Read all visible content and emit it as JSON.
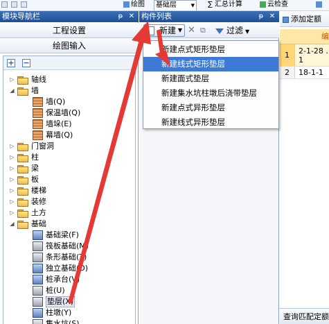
{
  "toolbar": {
    "items": [
      {
        "label": "绘图",
        "icon": "draw-icon"
      },
      {
        "label": "基础层",
        "icon": "layer-dropdown-icon"
      },
      {
        "label": "∑ 汇总计算",
        "icon": "sum-icon"
      },
      {
        "label": "云检查",
        "icon": "cloud-check-icon"
      }
    ]
  },
  "nav": {
    "title": "模块导航栏",
    "buttons": [
      "工程设置",
      "绘图输入"
    ],
    "tree": [
      {
        "label": "轴线",
        "level": 0,
        "expanded": false
      },
      {
        "label": "墙",
        "level": 0,
        "expanded": true
      },
      {
        "label": "墙(Q)",
        "level": 1,
        "icon": "wall-icon"
      },
      {
        "label": "保温墙(Q)",
        "level": 1,
        "icon": "insulation-wall-icon"
      },
      {
        "label": "墙垛(E)",
        "level": 1,
        "icon": "wall-pier-icon"
      },
      {
        "label": "幕墙(Q)",
        "level": 1,
        "icon": "curtain-wall-icon"
      },
      {
        "label": "门窗洞",
        "level": 0,
        "expanded": false
      },
      {
        "label": "柱",
        "level": 0,
        "expanded": false
      },
      {
        "label": "梁",
        "level": 0,
        "expanded": false
      },
      {
        "label": "板",
        "level": 0,
        "expanded": false
      },
      {
        "label": "楼梯",
        "level": 0,
        "expanded": false
      },
      {
        "label": "装修",
        "level": 0,
        "expanded": false
      },
      {
        "label": "土方",
        "level": 0,
        "expanded": false
      },
      {
        "label": "基础",
        "level": 0,
        "expanded": true
      },
      {
        "label": "基础梁(F)",
        "level": 1,
        "icon": "foundation-beam-icon"
      },
      {
        "label": "筏板基础(M)",
        "level": 1,
        "icon": "raft-foundation-icon"
      },
      {
        "label": "条形基础(T)",
        "level": 1,
        "icon": "strip-foundation-icon"
      },
      {
        "label": "独立基础(D)",
        "level": 1,
        "icon": "isolated-foundation-icon"
      },
      {
        "label": "桩承台(V)",
        "level": 1,
        "icon": "pile-cap-icon"
      },
      {
        "label": "桩(U)",
        "level": 1,
        "icon": "pile-icon"
      },
      {
        "label": "垫层(X)",
        "level": 1,
        "icon": "cushion-icon",
        "selected": true
      },
      {
        "label": "柱墩(Y)",
        "level": 1,
        "icon": "column-pier-icon"
      },
      {
        "label": "集水坑(S)",
        "level": 1,
        "icon": "sump-icon"
      }
    ]
  },
  "complist": {
    "title": "构件列表",
    "new_label": "新建",
    "filter_label": "过滤"
  },
  "menu": {
    "items": [
      {
        "label": "新建点式矩形垫层",
        "hover": false
      },
      {
        "label": "新建线式矩形垫层",
        "hover": true
      },
      {
        "label": "新建面式垫层",
        "hover": false
      },
      {
        "label": "新建集水坑柱墩后浇带垫层",
        "hover": false
      },
      {
        "label": "新建点式异形垫层",
        "hover": false
      },
      {
        "label": "新建线式异形垫层",
        "hover": false
      }
    ]
  },
  "right": {
    "add_label": "添加定额",
    "header_col": "编",
    "rows": [
      {
        "num": "1",
        "code": "2-1-28 .1"
      },
      {
        "num": "2",
        "code": "18-1-1"
      }
    ],
    "query_label": "查询匹配定额"
  },
  "colors": {
    "panel_header": "#1f4f93",
    "menu_highlight": "#3d7ad6",
    "annotation_arrow": "#e53935",
    "grid_header": "#ffe7a8"
  }
}
